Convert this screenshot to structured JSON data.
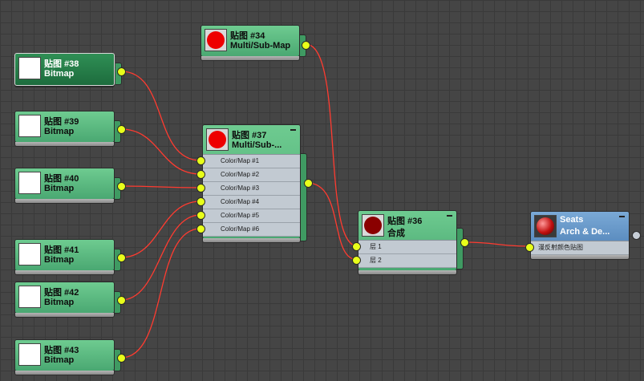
{
  "colors": {
    "wire": "#ff3b30",
    "port": "#e8ff1a",
    "node_green": "#5cba80",
    "node_selected": "#237a47",
    "node_blue": "#5f91c6",
    "swatch_red": "#ee0000",
    "swatch_dark_red": "#8a0000"
  },
  "nodes": {
    "map34": {
      "title": "贴图 #34",
      "subtitle": "Multi/Sub-Map",
      "icon": "red-swatch-icon"
    },
    "map38": {
      "title": "贴图 #38",
      "subtitle": "Bitmap",
      "icon": "bitmap-thumb-icon"
    },
    "map39": {
      "title": "贴图 #39",
      "subtitle": "Bitmap",
      "icon": "bitmap-thumb-icon"
    },
    "map40": {
      "title": "贴图 #40",
      "subtitle": "Bitmap",
      "icon": "bitmap-thumb-icon"
    },
    "map41": {
      "title": "贴图 #41",
      "subtitle": "Bitmap",
      "icon": "bitmap-thumb-icon"
    },
    "map42": {
      "title": "贴图 #42",
      "subtitle": "Bitmap",
      "icon": "bitmap-thumb-icon"
    },
    "map43": {
      "title": "贴图 #43",
      "subtitle": "Bitmap",
      "icon": "bitmap-thumb-icon"
    },
    "map37": {
      "title": "贴图 #37",
      "subtitle": "Multi/Sub-...",
      "icon": "red-swatch-icon",
      "slots": [
        "Color/Map #1",
        "Color/Map #2",
        "Color/Map #3",
        "Color/Map #4",
        "Color/Map #5",
        "Color/Map #6"
      ]
    },
    "map36": {
      "title": "贴图 #36",
      "subtitle": "合成",
      "icon": "dark-red-swatch-icon",
      "slots": [
        "层 1",
        "层 2"
      ]
    },
    "seats": {
      "title": "Seats",
      "subtitle": "Arch & De...",
      "icon": "material-sphere-icon",
      "slots": [
        "漫反射颜色贴图"
      ]
    }
  }
}
